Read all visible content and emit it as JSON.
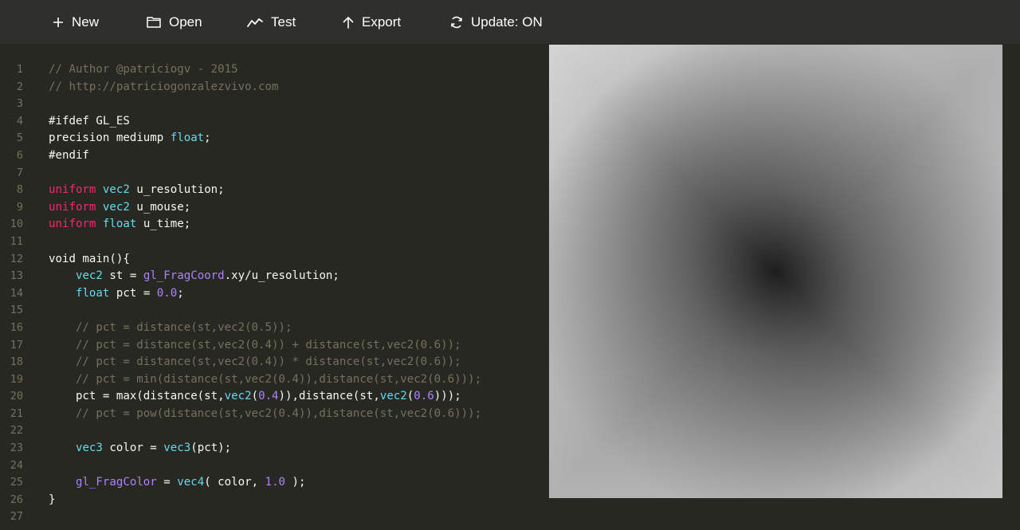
{
  "toolbar": {
    "new": {
      "label": "New",
      "icon": "plus-icon"
    },
    "open": {
      "label": "Open",
      "icon": "folder-icon"
    },
    "test": {
      "label": "Test",
      "icon": "trend-line-icon"
    },
    "export": {
      "label": "Export",
      "icon": "arrow-up-icon"
    },
    "update": {
      "label": "Update: ON",
      "icon": "refresh-icon"
    }
  },
  "editor": {
    "line_numbers": [
      "1",
      "2",
      "3",
      "4",
      "5",
      "6",
      "7",
      "8",
      "9",
      "10",
      "11",
      "12",
      "13",
      "14",
      "15",
      "16",
      "17",
      "18",
      "19",
      "20",
      "21",
      "22",
      "23",
      "24",
      "25",
      "26",
      "27"
    ],
    "lines": [
      [
        {
          "text": "// Author @patriciogv - 2015",
          "cls": "c"
        }
      ],
      [
        {
          "text": "// http://patriciogonzalezvivo.com",
          "cls": "c"
        }
      ],
      [],
      [
        {
          "text": "#ifdef GL_ES",
          "cls": ""
        }
      ],
      [
        {
          "text": "precision mediump ",
          "cls": ""
        },
        {
          "text": "float",
          "cls": "t"
        },
        {
          "text": ";",
          "cls": ""
        }
      ],
      [
        {
          "text": "#endif",
          "cls": ""
        }
      ],
      [],
      [
        {
          "text": "uniform",
          "cls": "k"
        },
        {
          "text": " ",
          "cls": ""
        },
        {
          "text": "vec2",
          "cls": "t"
        },
        {
          "text": " u_resolution;",
          "cls": ""
        }
      ],
      [
        {
          "text": "uniform",
          "cls": "k"
        },
        {
          "text": " ",
          "cls": ""
        },
        {
          "text": "vec2",
          "cls": "t"
        },
        {
          "text": " u_mouse;",
          "cls": ""
        }
      ],
      [
        {
          "text": "uniform",
          "cls": "k"
        },
        {
          "text": " ",
          "cls": ""
        },
        {
          "text": "float",
          "cls": "t"
        },
        {
          "text": " u_time;",
          "cls": ""
        }
      ],
      [],
      [
        {
          "text": "void main(){",
          "cls": ""
        }
      ],
      [
        {
          "text": "    ",
          "cls": ""
        },
        {
          "text": "vec2",
          "cls": "t"
        },
        {
          "text": " st = ",
          "cls": ""
        },
        {
          "text": "gl_FragCoord",
          "cls": "g"
        },
        {
          "text": ".xy/u_resolution;",
          "cls": ""
        }
      ],
      [
        {
          "text": "    ",
          "cls": ""
        },
        {
          "text": "float",
          "cls": "t"
        },
        {
          "text": " pct = ",
          "cls": ""
        },
        {
          "text": "0.0",
          "cls": "n"
        },
        {
          "text": ";",
          "cls": ""
        }
      ],
      [],
      [
        {
          "text": "    // pct = distance(st,vec2(0.5));",
          "cls": "c"
        }
      ],
      [
        {
          "text": "    // pct = distance(st,vec2(0.4)) + distance(st,vec2(0.6));",
          "cls": "c"
        }
      ],
      [
        {
          "text": "    // pct = distance(st,vec2(0.4)) * distance(st,vec2(0.6));",
          "cls": "c"
        }
      ],
      [
        {
          "text": "    // pct = min(distance(st,vec2(0.4)),distance(st,vec2(0.6)));",
          "cls": "c"
        }
      ],
      [
        {
          "text": "    pct = max(distance(st,",
          "cls": ""
        },
        {
          "text": "vec2",
          "cls": "t"
        },
        {
          "text": "(",
          "cls": ""
        },
        {
          "text": "0.4",
          "cls": "n"
        },
        {
          "text": ")),distance(st,",
          "cls": ""
        },
        {
          "text": "vec2",
          "cls": "t"
        },
        {
          "text": "(",
          "cls": ""
        },
        {
          "text": "0.6",
          "cls": "n"
        },
        {
          "text": ")));",
          "cls": ""
        }
      ],
      [
        {
          "text": "    // pct = pow(distance(st,vec2(0.4)),distance(st,vec2(0.6)));",
          "cls": "c"
        }
      ],
      [],
      [
        {
          "text": "    ",
          "cls": ""
        },
        {
          "text": "vec3",
          "cls": "t"
        },
        {
          "text": " color = ",
          "cls": ""
        },
        {
          "text": "vec3",
          "cls": "t"
        },
        {
          "text": "(pct);",
          "cls": ""
        }
      ],
      [],
      [
        {
          "text": "    ",
          "cls": ""
        },
        {
          "text": "gl_FragColor",
          "cls": "g"
        },
        {
          "text": " = ",
          "cls": ""
        },
        {
          "text": "vec4",
          "cls": "t"
        },
        {
          "text": "( color, ",
          "cls": ""
        },
        {
          "text": "1.0",
          "cls": "n"
        },
        {
          "text": " );",
          "cls": ""
        }
      ],
      [
        {
          "text": "}",
          "cls": ""
        }
      ],
      []
    ]
  },
  "preview": {
    "shader_points": [
      [
        0.4,
        0.4
      ],
      [
        0.6,
        0.6
      ]
    ],
    "mode": "max-distance"
  }
}
